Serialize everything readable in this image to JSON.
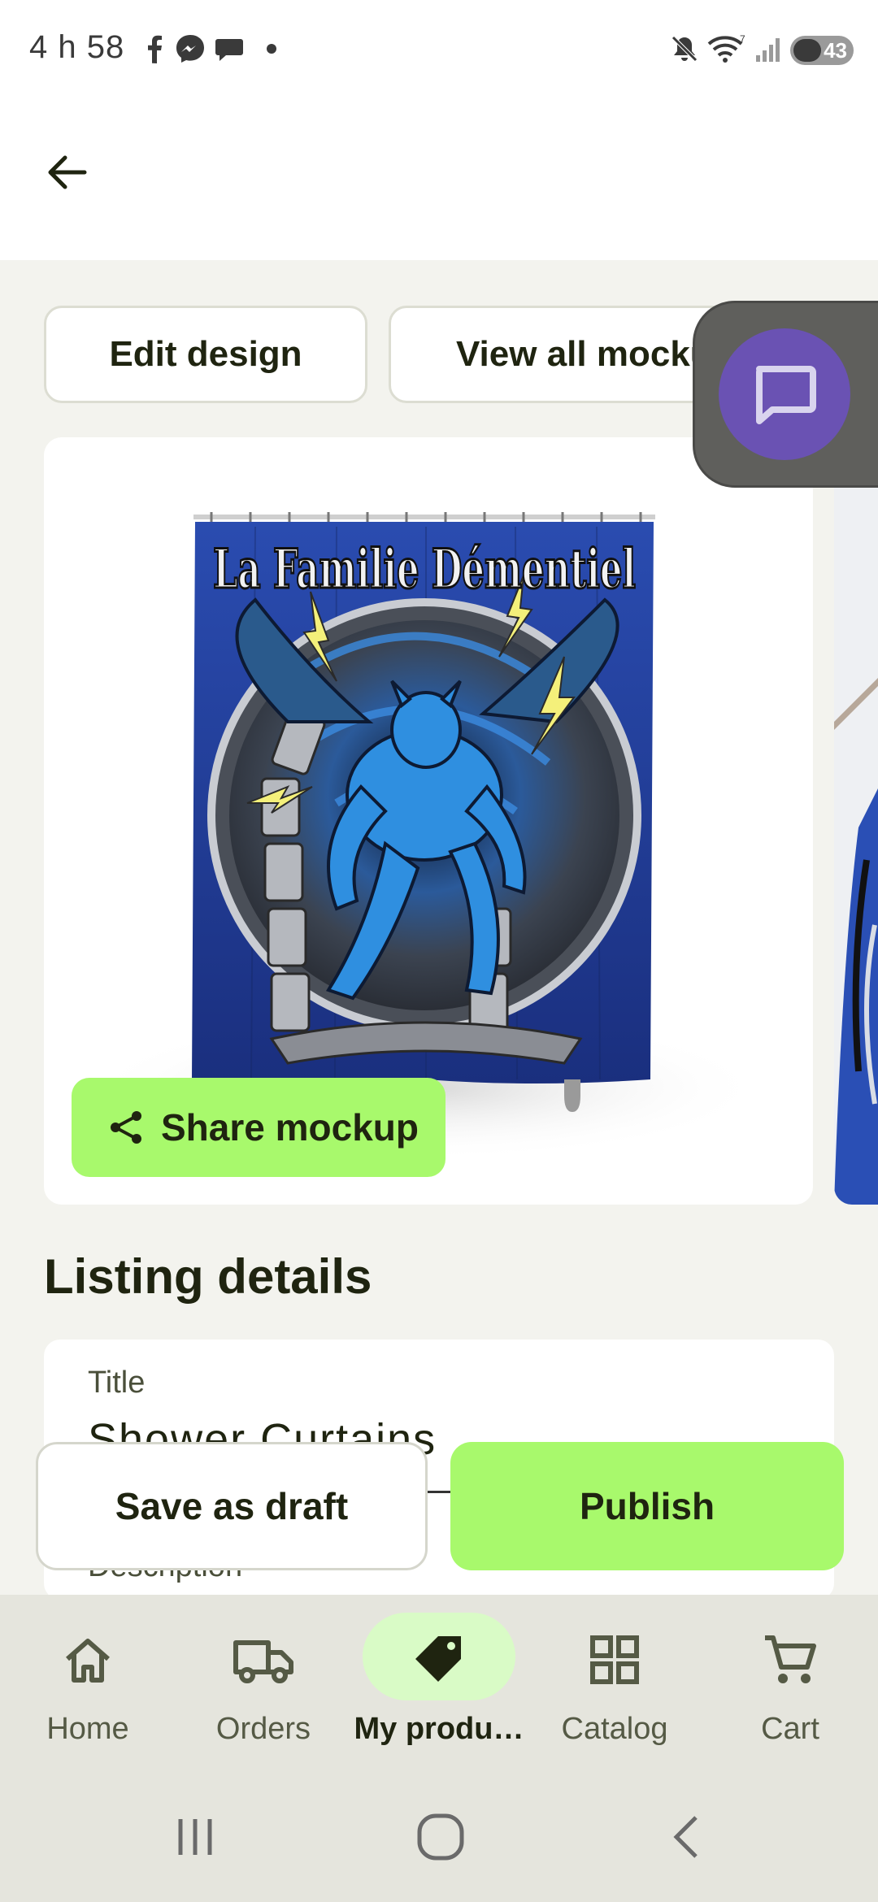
{
  "status_bar": {
    "time": "4 h 58",
    "battery": "43",
    "icons": [
      "facebook-icon",
      "messenger-icon",
      "chat-bubble-icon",
      "dot-icon",
      "mute-icon",
      "wifi-icon",
      "signal-icon",
      "battery-icon"
    ]
  },
  "actions": {
    "edit_design": "Edit design",
    "view_all_mockups": "View all mockups"
  },
  "mockup": {
    "design_text": "La Familie Démentiel",
    "share_label": "Share mockup"
  },
  "listing": {
    "heading": "Listing details",
    "title_label": "Title",
    "title_value": "Shower Curtains",
    "description_label": "Description"
  },
  "footer_actions": {
    "save_draft": "Save as draft",
    "publish": "Publish"
  },
  "nav": {
    "items": [
      {
        "label": "Home",
        "icon": "home-icon"
      },
      {
        "label": "Orders",
        "icon": "truck-icon"
      },
      {
        "label": "My produ…",
        "icon": "tag-icon",
        "active": true
      },
      {
        "label": "Catalog",
        "icon": "grid-icon"
      },
      {
        "label": "Cart",
        "icon": "cart-icon"
      }
    ]
  },
  "colors": {
    "accent_green": "#a8f96c",
    "chat_purple": "#6a52b3",
    "background": "#f3f3ee",
    "curtain_blue": "#1f3a93"
  }
}
